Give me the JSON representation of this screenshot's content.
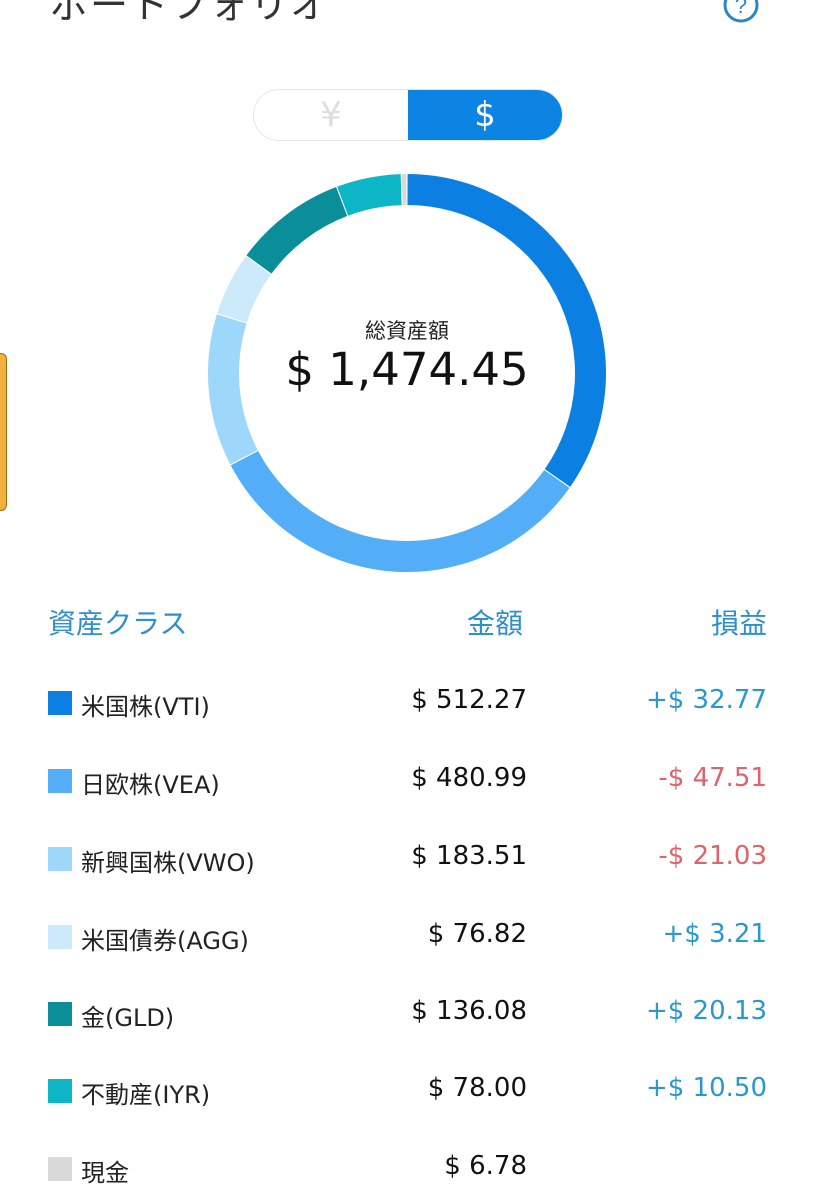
{
  "header": {
    "title": "ポートフォリオ",
    "help_icon": "help-circle-icon"
  },
  "currency_toggle": {
    "options": [
      "¥",
      "$"
    ],
    "selected": "$"
  },
  "summary": {
    "label": "総資産額",
    "total": "$ 1,474.45"
  },
  "table": {
    "headers": {
      "asset_class": "資産クラス",
      "amount": "金額",
      "profit_loss": "損益"
    },
    "rows": [
      {
        "name": "米国株(VTI)",
        "amount": "$ 512.27",
        "pl": "+$ 32.77",
        "value": 512.27,
        "color": "#0c7fe2"
      },
      {
        "name": "日欧株(VEA)",
        "amount": "$ 480.99",
        "pl": "-$ 47.51",
        "value": 480.99,
        "color": "#53aef7"
      },
      {
        "name": "新興国株(VWO)",
        "amount": "$ 183.51",
        "pl": "-$ 21.03",
        "value": 183.51,
        "color": "#9dd8fb"
      },
      {
        "name": "米国債券(AGG)",
        "amount": "$ 76.82",
        "pl": "+$ 3.21",
        "value": 76.82,
        "color": "#cdeafb"
      },
      {
        "name": "金(GLD)",
        "amount": "$ 136.08",
        "pl": "+$ 20.13",
        "value": 136.08,
        "color": "#0a8f9a"
      },
      {
        "name": "不動産(IYR)",
        "amount": "$ 78.00",
        "pl": "+$ 10.50",
        "value": 78.0,
        "color": "#0db6c6"
      },
      {
        "name": "現金",
        "amount": "$ 6.78",
        "pl": "",
        "value": 6.78,
        "color": "#d9d9d9"
      }
    ]
  },
  "colors": {
    "accent": "#0c84e4",
    "header_text": "#2e8fd0",
    "positive": "#2a98cf",
    "negative": "#e0626b",
    "side_tab": "#f3b23f"
  }
}
